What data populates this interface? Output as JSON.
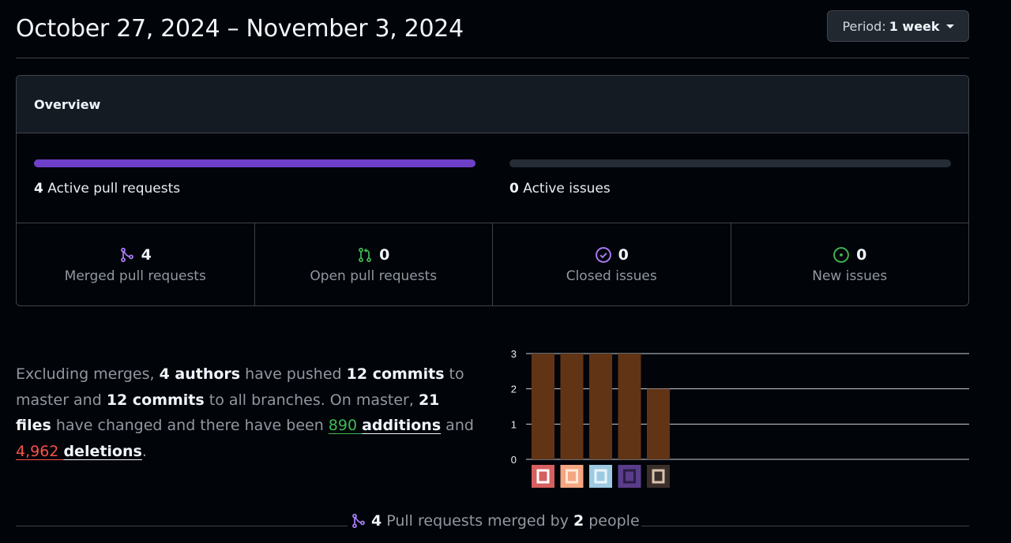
{
  "header": {
    "date_range": "October 27, 2024 – November 3, 2024",
    "period_prefix": "Period:",
    "period_value": "1 week"
  },
  "overview": {
    "title": "Overview",
    "active_prs": {
      "count": "4",
      "label": "Active pull requests",
      "fill_fraction": 1.0
    },
    "active_issues": {
      "count": "0",
      "label": "Active issues",
      "fill_fraction": 0.0
    },
    "stats": [
      {
        "icon": "git-merge-icon",
        "count": "4",
        "label": "Merged pull requests",
        "color": "#ab7df8"
      },
      {
        "icon": "git-pull-request-icon",
        "count": "0",
        "label": "Open pull requests",
        "color": "#3fb950"
      },
      {
        "icon": "issue-closed-icon",
        "count": "0",
        "label": "Closed issues",
        "color": "#ab7df8"
      },
      {
        "icon": "issue-opened-icon",
        "count": "0",
        "label": "New issues",
        "color": "#3fb950"
      }
    ]
  },
  "summary": {
    "t1": "Excluding merges, ",
    "authors": "4 authors",
    "t2": " have pushed ",
    "commits_master": "12 commits",
    "t3": " to master and ",
    "commits_all": "12 commits",
    "t4": " to all branches. On master, ",
    "files": "21 files",
    "t5": " have changed and there have been ",
    "additions_num": "890",
    "additions_word": "additions",
    "t6": " and ",
    "deletions_num": "4,962",
    "deletions_word": "deletions",
    "t7": "."
  },
  "chart_data": {
    "type": "bar",
    "categories": [
      "author-1",
      "author-2",
      "author-3",
      "author-4",
      "author-5"
    ],
    "values": [
      3,
      3,
      3,
      3,
      2
    ],
    "ylim": [
      0,
      3
    ],
    "yticks": [
      "0",
      "1",
      "2",
      "3"
    ],
    "bar_color": "#623416",
    "grid": true
  },
  "footer": {
    "count": "4",
    "t1": "Pull requests merged by",
    "people": "2",
    "t2": "people"
  },
  "colors": {
    "accent_purple": "#6e40c9",
    "merged_purple": "#ab7df8",
    "green": "#3fb950",
    "red": "#f85149"
  }
}
